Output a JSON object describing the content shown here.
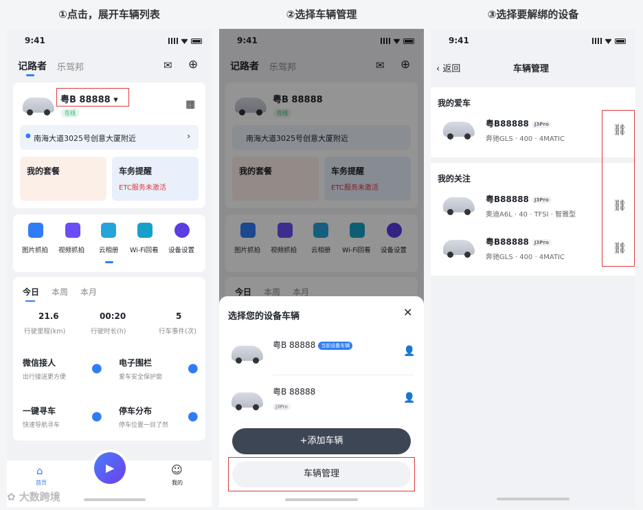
{
  "steps": [
    "①点击，展开车辆列表",
    "②选择车辆管理",
    "③选择要解绑的设备"
  ],
  "status_time": "9:41",
  "home": {
    "tab_active": "记路者",
    "tab_other": "乐驾邦",
    "plate": "粤B 88888",
    "online": "在线",
    "location": "南海大道3025号创意大厦附近",
    "package": "我的套餐",
    "reminder": "车务提醒",
    "reminder_sub": "ETC服务未激活",
    "quick": [
      "图片抓拍",
      "视频抓拍",
      "云相册",
      "Wi-Fi回看",
      "设备设置"
    ],
    "period_tabs": [
      "今日",
      "本周",
      "本月"
    ],
    "stats": [
      {
        "value": "21.6",
        "label": "行驶里程(km)"
      },
      {
        "value": "00:20",
        "label": "行驶时长(h)"
      },
      {
        "value": "5",
        "label": "行车事件(次)"
      }
    ],
    "features": [
      {
        "title": "微信接人",
        "sub": "出行接送更方便"
      },
      {
        "title": "电子围栏",
        "sub": "爱车安全保护窗"
      },
      {
        "title": "一键寻车",
        "sub": "快速导航寻车"
      },
      {
        "title": "停车分布",
        "sub": "停车位置一目了然"
      }
    ],
    "nav_home": "首页",
    "nav_mine": "我的"
  },
  "sheet": {
    "title": "选择您的设备车辆",
    "car1_plate": "粤B 88888",
    "car1_tag": "当前设备车辆",
    "car2_plate": "粤B 88888",
    "car2_tag": "J3Pro",
    "add": "+添加车辆",
    "manage": "车辆管理"
  },
  "manage": {
    "back": "返回",
    "title": "车辆管理",
    "my_car": "我的爱车",
    "follow": "我的关注",
    "cars": [
      {
        "plate": "粤B88888",
        "tag": "J3Pro",
        "model": "奔驰GLS · 400 · 4MATIC"
      },
      {
        "plate": "粤B88888",
        "tag": "J3Pro",
        "model": "奥迪A6L · 40 · TFSI · 智雅型"
      },
      {
        "plate": "粤B88888",
        "tag": "J3Pro",
        "model": "奔驰GLS · 400 · 4MATIC"
      }
    ]
  },
  "watermark": "大数跨境"
}
